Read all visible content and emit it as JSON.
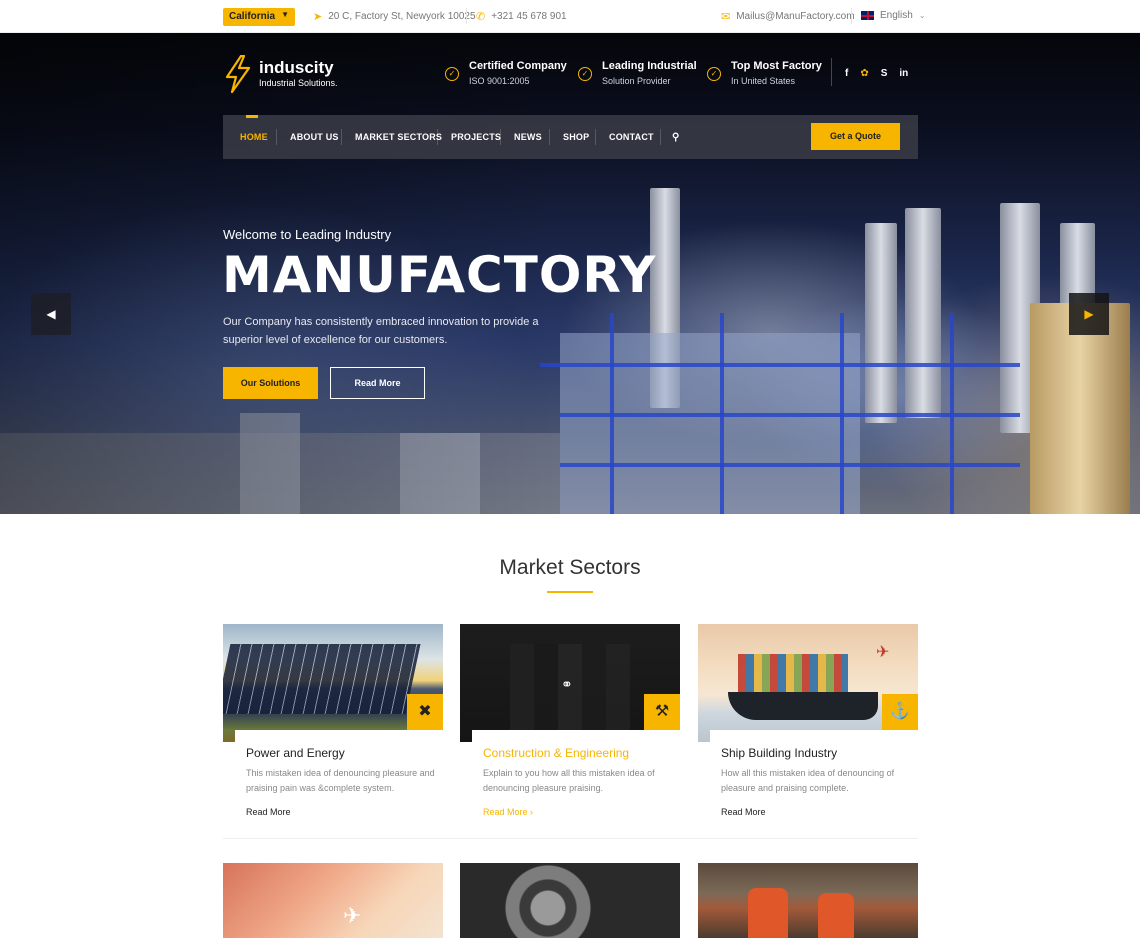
{
  "topbar": {
    "location": "California",
    "address": "20 C, Factory St, Newyork 10025",
    "phone": "+321 45 678 901",
    "email": "Mailus@ManuFactory.com",
    "language": "English"
  },
  "logo": {
    "name": "induscity",
    "tagline": "Industrial Solutions."
  },
  "features": [
    {
      "title": "Certified Company",
      "subtitle": "ISO 9001:2005"
    },
    {
      "title": "Leading Industrial",
      "subtitle": "Solution Provider"
    },
    {
      "title": "Top Most Factory",
      "subtitle": "In United States"
    }
  ],
  "socials": [
    "facebook-icon",
    "twitter-icon",
    "skype-icon",
    "linkedin-icon"
  ],
  "nav": {
    "items": [
      "HOME",
      "ABOUT US",
      "MARKET SECTORS",
      "PROJECTS",
      "NEWS",
      "SHOP",
      "CONTACT"
    ],
    "active": "HOME",
    "cta": "Get a Quote"
  },
  "hero": {
    "subtitle": "Welcome to Leading Industry",
    "title": "MANUFACTORY",
    "description": "Our Company has consistently embraced innovation to provide a superior level of excellence for our customers.",
    "primary_button": "Our Solutions",
    "secondary_button": "Read More"
  },
  "sectors": {
    "heading": "Market Sectors",
    "cards": [
      {
        "title": "Power and Energy",
        "description": "This mistaken idea of denouncing pleasure and praising pain was &complete system.",
        "link": "Read More",
        "icon": "windmill-icon"
      },
      {
        "title": "Construction & Engineering",
        "description": "Explain to you how all this mistaken idea of denouncing pleasure praising.",
        "link": "Read More",
        "icon": "crane-icon"
      },
      {
        "title": "Ship Building Industry",
        "description": "How all this mistaken idea of denouncing of pleasure and praising complete.",
        "link": "Read More",
        "icon": "ship-icon"
      }
    ]
  },
  "colors": {
    "accent": "#f7b500",
    "dark": "#222222"
  }
}
